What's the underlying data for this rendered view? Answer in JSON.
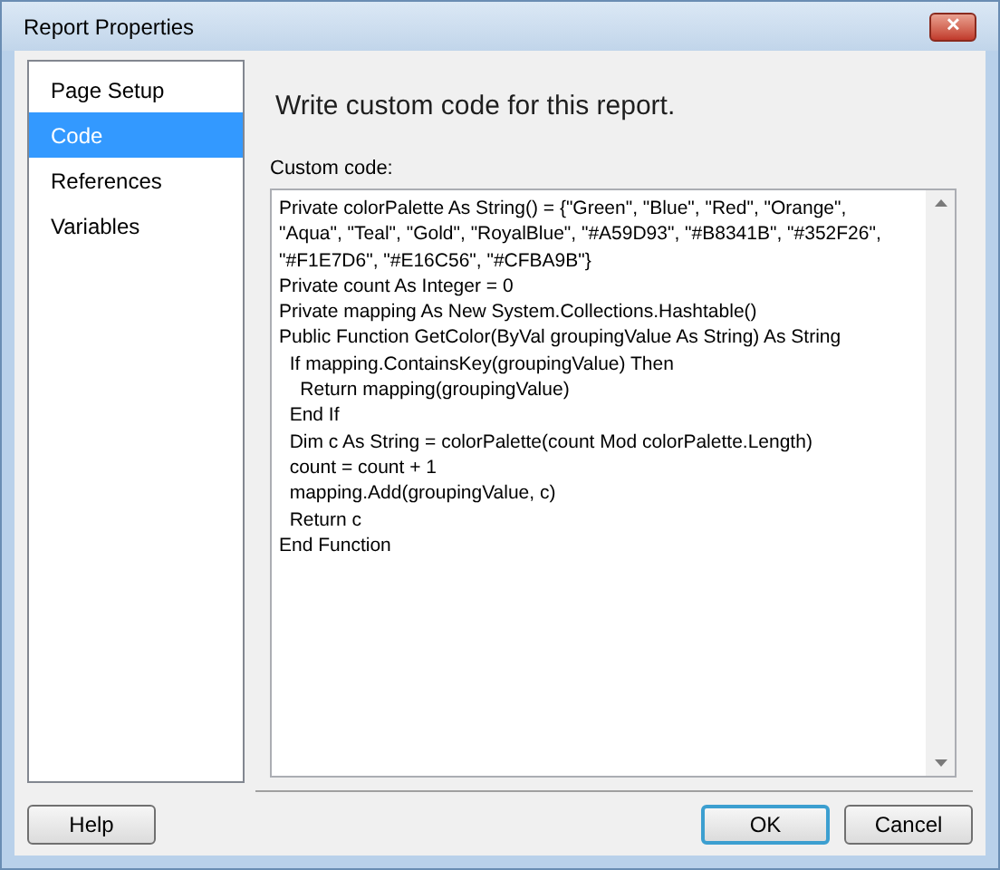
{
  "window": {
    "title": "Report Properties",
    "close": "✕"
  },
  "sidebar": {
    "items": [
      {
        "label": "Page Setup",
        "selected": false
      },
      {
        "label": "Code",
        "selected": true
      },
      {
        "label": "References",
        "selected": false
      },
      {
        "label": "Variables",
        "selected": false
      }
    ]
  },
  "heading": "Write custom code for this report.",
  "custom_code": {
    "label": "Custom code:",
    "lines": [
      "Private colorPalette As String() = {\"Green\", \"Blue\", \"Red\", \"Orange\",",
      "\"Aqua\", \"Teal\", \"Gold\", \"RoyalBlue\", \"#A59D93\", \"#B8341B\", \"#352F26\",",
      "\"#F1E7D6\", \"#E16C56\", \"#CFBA9B\"}",
      "Private count As Integer = 0",
      "Private mapping As New System.Collections.Hashtable()",
      "Public Function GetColor(ByVal groupingValue As String) As String",
      "  If mapping.ContainsKey(groupingValue) Then",
      "    Return mapping(groupingValue)",
      "  End If",
      "  Dim c As String = colorPalette(count Mod colorPalette.Length)",
      "  count = count + 1",
      "  mapping.Add(groupingValue, c)",
      "  Return c",
      "End Function"
    ]
  },
  "buttons": [
    {
      "label": "Help",
      "default": false
    },
    {
      "label": "OK",
      "default": true
    },
    {
      "label": "Cancel",
      "default": false
    }
  ]
}
